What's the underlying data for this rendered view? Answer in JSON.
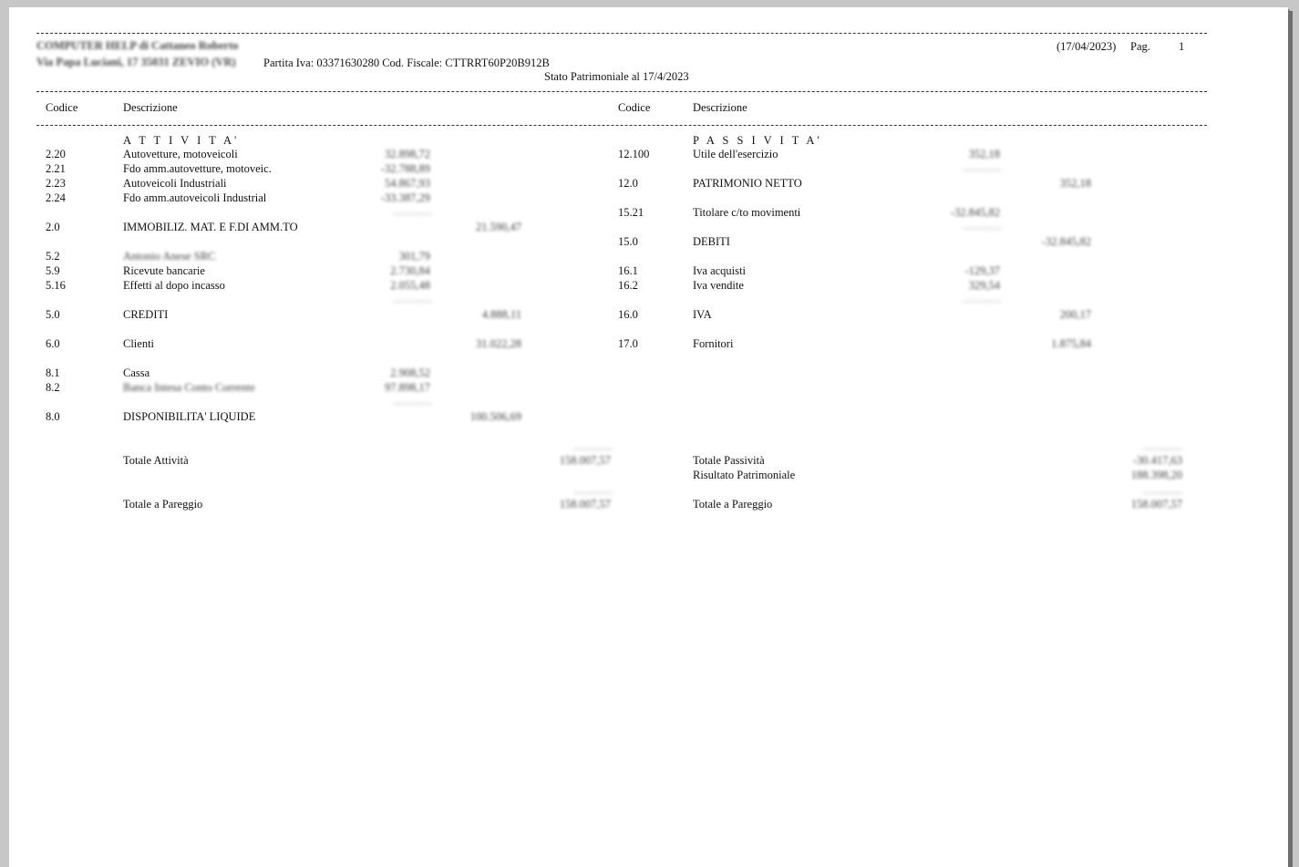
{
  "header": {
    "company_name": "COMPUTER HELP di Cattaneo Roberto",
    "company_address": "Via Papa Luciani, 17   35031 ZEVIO (VR)",
    "tax_info": "Partita Iva: 03371630280 Cod. Fiscale: CTTRRT60P20B912B",
    "date": "(17/04/2023)",
    "page_label": "Pag.",
    "page_number": "1",
    "report_title": "Stato Patrimoniale al 17/4/2023"
  },
  "columns": {
    "left_code": "Codice",
    "left_desc": "Descrizione",
    "right_code": "Codice",
    "right_desc": "Descrizione"
  },
  "left": {
    "section_title": "A T T I V I T A'",
    "rows": [
      {
        "code": "2.20",
        "desc": "Autovetture, motoveicoli",
        "amount": "32.898,72"
      },
      {
        "code": "2.21",
        "desc": "Fdo amm.autovetture, motoveic.",
        "amount": "-32.788,89"
      },
      {
        "code": "2.23",
        "desc": "Autoveicoli Industriali",
        "amount": "54.867,93"
      },
      {
        "code": "2.24",
        "desc": "Fdo amm.autoveicoli Industrial",
        "amount": "-33.387,29"
      },
      {
        "code": "2.0",
        "desc": "IMMOBILIZ. MAT. E  F.DI AMM.TO",
        "total": "21.590,47"
      },
      {
        "code": "5.2",
        "desc": "Antonio Anese SRC",
        "amount": "301,79"
      },
      {
        "code": "5.9",
        "desc": "Ricevute bancarie",
        "amount": "2.730,84"
      },
      {
        "code": "5.16",
        "desc": "Effetti al dopo incasso",
        "amount": "2.055,48"
      },
      {
        "code": "5.0",
        "desc": "CREDITI",
        "total": "4.888,11"
      },
      {
        "code": "6.0",
        "desc": "Clienti",
        "total": "31.022,28"
      },
      {
        "code": "8.1",
        "desc": "Cassa",
        "amount": "2.908,52"
      },
      {
        "code": "8.2",
        "desc": "Banca Intesa Conto Corrente",
        "amount": "97.898,17"
      },
      {
        "code": "8.0",
        "desc": "DISPONIBILITA' LIQUIDE",
        "total": "100.506,69"
      }
    ],
    "sum_separators": [
      "----------------",
      "----------------",
      "----------------"
    ],
    "totale_label": "Totale Attività",
    "totale_value": "158.007,57",
    "pareggio_label": "Totale a Pareggio",
    "pareggio_value": "158.007,57"
  },
  "right": {
    "section_title": "P A S S I V I T A'",
    "rows": [
      {
        "code": "12.100",
        "desc": "Utile dell'esercizio",
        "amount": "352,18"
      },
      {
        "code": "12.0",
        "desc": "PATRIMONIO NETTO",
        "total": "352,18"
      },
      {
        "code": "15.21",
        "desc": "Titolare c/to movimenti",
        "amount": "-32.845,82"
      },
      {
        "code": "15.0",
        "desc": "DEBITI",
        "total": "-32.845,82"
      },
      {
        "code": "16.1",
        "desc": "Iva acquisti",
        "amount": "-129,37"
      },
      {
        "code": "16.2",
        "desc": "Iva vendite",
        "amount": "329,54"
      },
      {
        "code": "16.0",
        "desc": "IVA",
        "total": "200,17"
      },
      {
        "code": "17.0",
        "desc": "Fornitori",
        "total": "1.875,84"
      }
    ],
    "sum_separators": [
      "----------------",
      "----------------",
      "----------------"
    ],
    "totale_label": "Totale Passività",
    "totale_value": "-30.417,63",
    "risultato_label": "Risultato Patrimoniale",
    "risultato_value": "188.398,20",
    "pareggio_label": "Totale a Pareggio",
    "pareggio_value": "158.007,57"
  }
}
